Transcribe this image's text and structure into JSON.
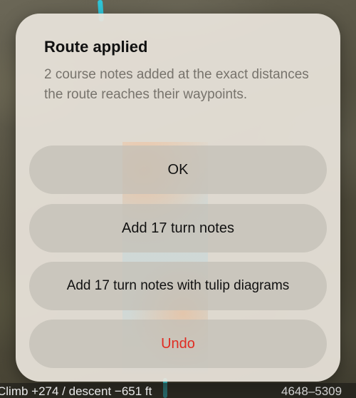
{
  "dialog": {
    "title": "Route applied",
    "message": "2 course notes added at the exact distances the route reaches their waypoints.",
    "buttons": {
      "ok": "OK",
      "add_turn_notes": "Add 17 turn notes",
      "add_tulip_notes": "Add 17 turn notes with tulip diagrams",
      "undo": "Undo"
    }
  },
  "status_bar": {
    "elevation": "Climb +274 / descent −651 ft",
    "range": "4648–5309"
  },
  "colors": {
    "route": "#2fc6d9",
    "undo_text": "#e02c22",
    "dialog_bg": "#e9e4db",
    "button_bg": "#c4c0b7"
  }
}
